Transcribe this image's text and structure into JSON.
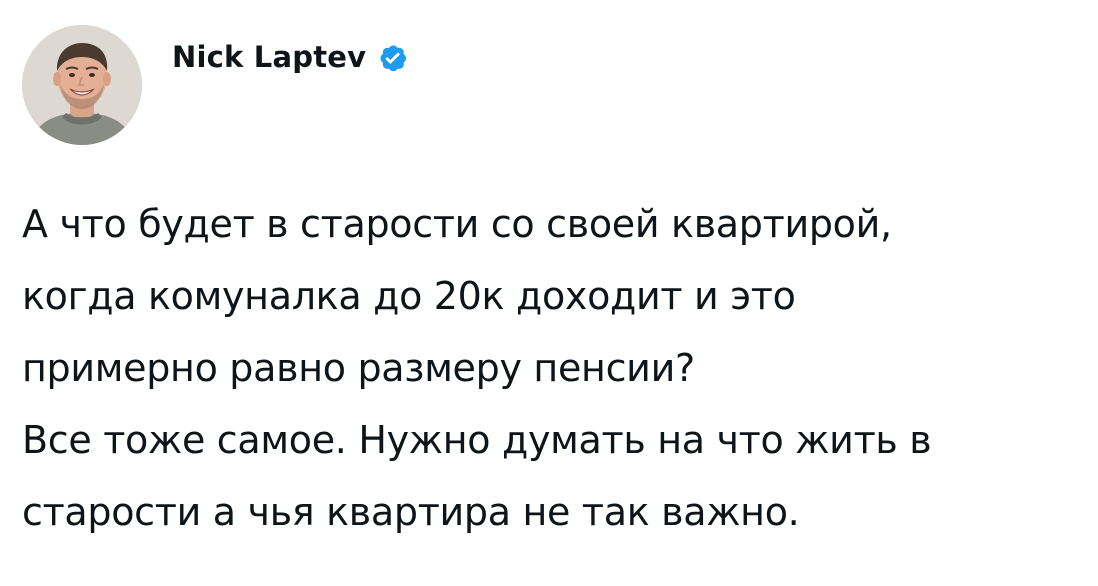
{
  "author": {
    "name": "Nick Laptev",
    "verified": true,
    "avatar_icon": "profile-photo",
    "verified_icon": "verified-badge-icon"
  },
  "tweet": {
    "lines": [
      "А что будет в старости со своей квартирой,",
      "когда комуналка до 20к доходит и это",
      "примерно равно размеру пенсии?",
      "Все тоже самое. Нужно думать на что жить в",
      "старости а чья квартира не так важно."
    ]
  },
  "colors": {
    "text": "#0f1419",
    "verified_blue": "#1d9bf0",
    "background": "#ffffff"
  }
}
